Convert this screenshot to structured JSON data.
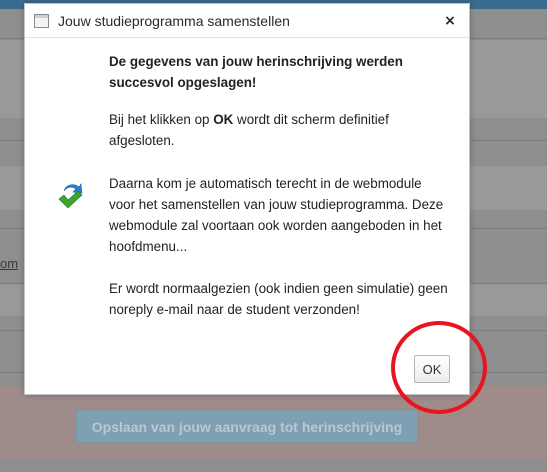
{
  "background": {
    "link_fragment": "om",
    "submit_button_label": "Opslaan van jouw aanvraag tot herinschrijving"
  },
  "dialog": {
    "title": "Jouw studieprogramma samenstellen",
    "close_label": "×",
    "success_message": "De gegevens van jouw herinschrijving werden succesvol opgeslagen!",
    "close_info_prefix": "Bij het klikken op ",
    "close_info_emphasis": "OK",
    "close_info_suffix": " wordt dit scherm definitief afgesloten.",
    "redirect_info": "Daarna kom je automatisch terecht in de webmodule voor het samenstellen van jouw studieprogramma. Deze webmodule zal voortaan ook worden aangeboden in het hoofdmenu...",
    "mail_info": "Er wordt normaalgezien (ook indien geen simulatie) geen noreply e-mail naar de student verzonden!",
    "ok_label": "OK"
  },
  "colors": {
    "annotation_circle": "#e8141f",
    "check_green": "#3aa52f",
    "arrow_blue": "#2f7fd0"
  },
  "icons": {
    "title": "window-icon",
    "close": "close-icon",
    "status": "check-arrow-icon"
  }
}
